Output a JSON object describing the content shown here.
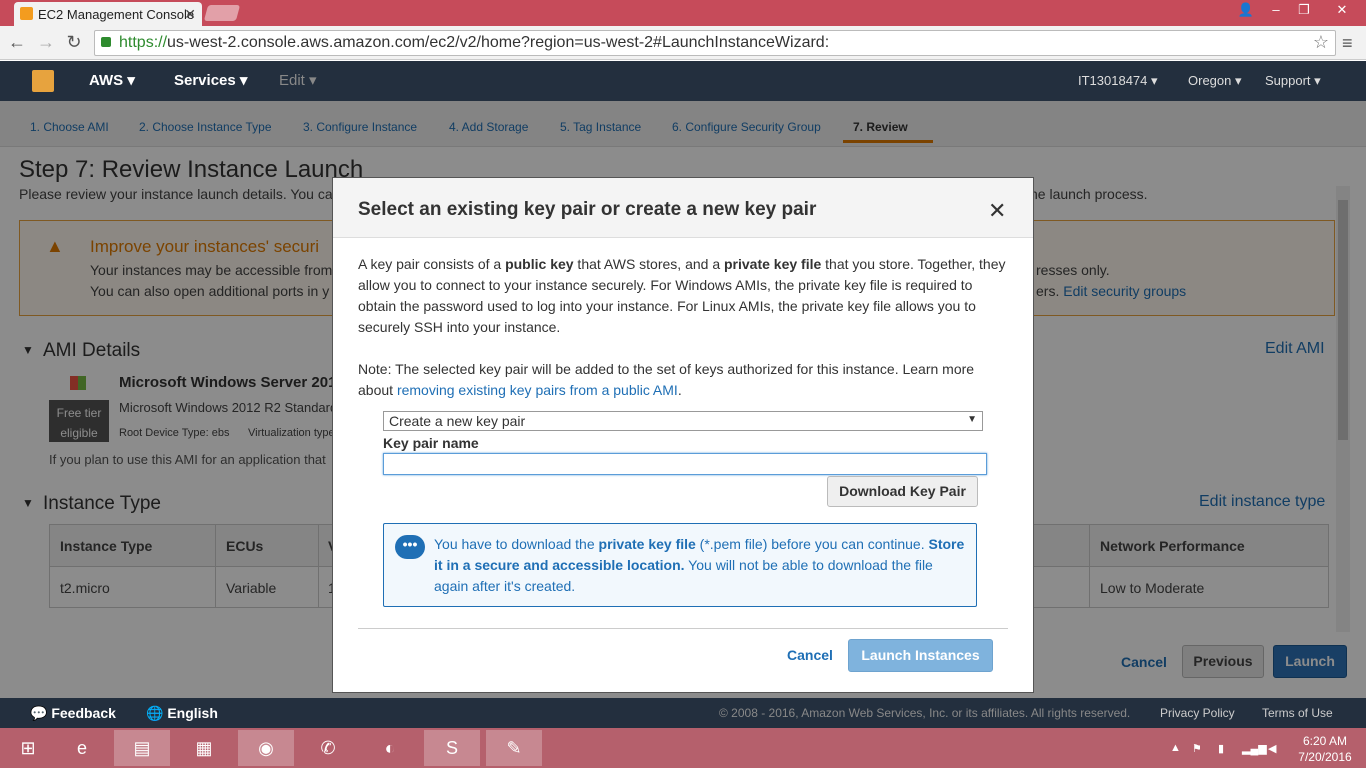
{
  "browser": {
    "tab_title": "EC2 Management Console",
    "url_https": "https://",
    "url_rest": "us-west-2.console.aws.amazon.com/ec2/v2/home?region=us-west-2#LaunchInstanceWizard:"
  },
  "awsnav": {
    "aws": "AWS",
    "services": "Services",
    "edit": "Edit",
    "account": "IT13018474",
    "region": "Oregon",
    "support": "Support"
  },
  "steps": [
    "1. Choose AMI",
    "2. Choose Instance Type",
    "3. Configure Instance",
    "4. Add Storage",
    "5. Tag Instance",
    "6. Configure Security Group",
    "7. Review"
  ],
  "page": {
    "title": "Step 7: Review Instance Launch",
    "sub_left": "Please review your instance launch details. You ca",
    "sub_right": "he launch process.",
    "warn_title": "Improve your instances' securi",
    "warn_l1": "Your instances may be accessible from",
    "warn_l2": "You can also open additional ports in y",
    "warn_r1": "resses only.",
    "warn_r2_pre": "ers.",
    "warn_r2_link": "Edit security groups",
    "ami_section": "AMI Details",
    "edit_ami": "Edit AMI",
    "ami_name": "Microsoft Windows Server 201",
    "ami_desc": "Microsoft Windows 2012 R2 Standard",
    "ami_root": "Root Device Type: ebs",
    "ami_virt": "Virtualization type",
    "free_tier_1": "Free tier",
    "free_tier_2": "eligible",
    "ami_plan": "If you plan to use this AMI for an application that",
    "type_section": "Instance Type",
    "edit_type": "Edit instance type",
    "table_headers": [
      "Instance Type",
      "ECUs",
      "V",
      "Network Performance"
    ],
    "table_row": [
      "t2.micro",
      "Variable",
      "1",
      "Low to Moderate"
    ],
    "cancel": "Cancel",
    "previous": "Previous",
    "launch": "Launch"
  },
  "modal": {
    "title": "Select an existing key pair or create a new key pair",
    "p1_a": "A key pair consists of a ",
    "p1_b": "public key",
    "p1_c": " that AWS stores, and a ",
    "p1_d": "private key file",
    "p1_e": " that you store. Together, they allow you to connect to your instance securely. For Windows AMIs, the private key file is required to obtain the password used to log into your instance. For Linux AMIs, the private key file allows you to securely SSH into your instance.",
    "note_a": "Note: The selected key pair will be added to the set of keys authorized for this instance. Learn more about ",
    "note_link": "removing existing key pairs from a public AMI",
    "note_end": ".",
    "select_value": "Create a new key pair",
    "kp_label": "Key pair name",
    "kp_value": "",
    "download": "Download Key Pair",
    "info_a": "You have to download the ",
    "info_b": "private key file",
    "info_c": " (*.pem file) before you can continue. ",
    "info_d": "Store it in a secure and accessible location.",
    "info_e": " You will not be able to download the file again after it's created.",
    "cancel": "Cancel",
    "launch": "Launch Instances"
  },
  "footer": {
    "feedback": "Feedback",
    "language": "English",
    "copyright": "© 2008 - 2016, Amazon Web Services, Inc. or its affiliates. All rights reserved.",
    "privacy": "Privacy Policy",
    "terms": "Terms of Use"
  },
  "taskbar": {
    "time": "6:20 AM",
    "date": "7/20/2016"
  }
}
